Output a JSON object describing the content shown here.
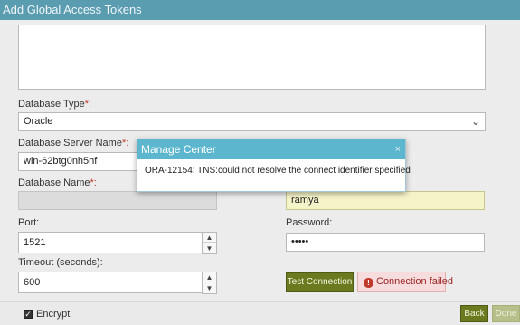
{
  "window": {
    "title": "Add Global Access Tokens"
  },
  "form": {
    "database_type": {
      "label": "Database Type",
      "required_mark": "*:",
      "value": "Oracle"
    },
    "server_name": {
      "label": "Database Server Name",
      "required_mark": "*:",
      "value": "win-62btg0nh5hf"
    },
    "database_name": {
      "label": "Database Name",
      "required_mark": "*:",
      "value": ""
    },
    "username": {
      "value": "ramya"
    },
    "port": {
      "label": "Port:",
      "value": "1521"
    },
    "password": {
      "label": "Password:",
      "value": "•••••"
    },
    "timeout": {
      "label": "Timeout (seconds):",
      "value": "600"
    },
    "test_button": "Test Connection",
    "status": {
      "text": "Connection failed",
      "icon": "error-icon",
      "color": "#c0392b"
    },
    "encrypt": {
      "label": "Encrypt",
      "checked": true
    }
  },
  "footer": {
    "back_label": "Back",
    "done_label": "Done"
  },
  "modal": {
    "title": "Manage Center",
    "close_glyph": "×",
    "message": "ORA-12154: TNS:could not resolve the connect identifier specified"
  },
  "icons": {
    "dropdown": "chevron-down-icon",
    "spin_up": "caret-up-icon",
    "spin_down": "caret-down-icon"
  },
  "colors": {
    "header": "#5a9db1",
    "modal_header": "#5cb6cd",
    "primary_button": "#6b7a1e",
    "disabled_button": "#b7c08b"
  }
}
